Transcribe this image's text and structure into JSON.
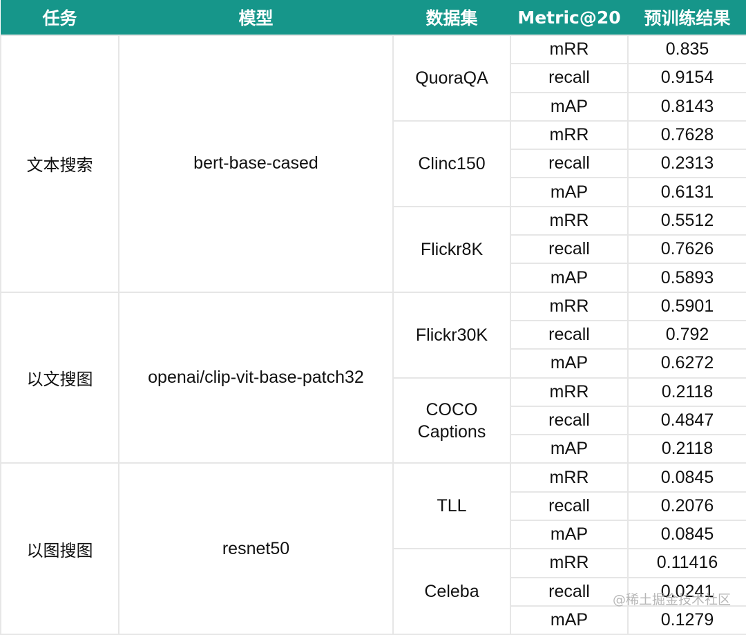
{
  "header": [
    "任务",
    "模型",
    "数据集",
    "Metric@20",
    "预训练结果"
  ],
  "groups": [
    {
      "task": "文本搜索",
      "model": "bert-base-cased",
      "datasets": [
        {
          "name": "QuoraQA",
          "rows": [
            [
              "mRR",
              "0.835"
            ],
            [
              "recall",
              "0.9154"
            ],
            [
              "mAP",
              "0.8143"
            ]
          ]
        },
        {
          "name": "Clinc150",
          "rows": [
            [
              "mRR",
              "0.7628"
            ],
            [
              "recall",
              "0.2313"
            ],
            [
              "mAP",
              "0.6131"
            ]
          ]
        },
        {
          "name": "Flickr8K",
          "rows": [
            [
              "mRR",
              "0.5512"
            ],
            [
              "recall",
              "0.7626"
            ],
            [
              "mAP",
              "0.5893"
            ]
          ]
        }
      ]
    },
    {
      "task": "以文搜图",
      "model": "openai/clip-vit-base-patch32",
      "datasets": [
        {
          "name": "Flickr30K",
          "rows": [
            [
              "mRR",
              "0.5901"
            ],
            [
              "recall",
              "0.792"
            ],
            [
              "mAP",
              "0.6272"
            ]
          ]
        },
        {
          "name": "COCO\nCaptions",
          "rows": [
            [
              "mRR",
              "0.2118"
            ],
            [
              "recall",
              "0.4847"
            ],
            [
              "mAP",
              "0.2118"
            ]
          ]
        }
      ]
    },
    {
      "task": "以图搜图",
      "model": "resnet50",
      "datasets": [
        {
          "name": "TLL",
          "rows": [
            [
              "mRR",
              "0.0845"
            ],
            [
              "recall",
              "0.2076"
            ],
            [
              "mAP",
              "0.0845"
            ]
          ]
        },
        {
          "name": "Celeba",
          "rows": [
            [
              "mRR",
              "0.11416"
            ],
            [
              "recall",
              "0.0241"
            ],
            [
              "mAP",
              "0.1279"
            ]
          ]
        }
      ]
    }
  ],
  "watermark": "@稀土掘金技术社区"
}
